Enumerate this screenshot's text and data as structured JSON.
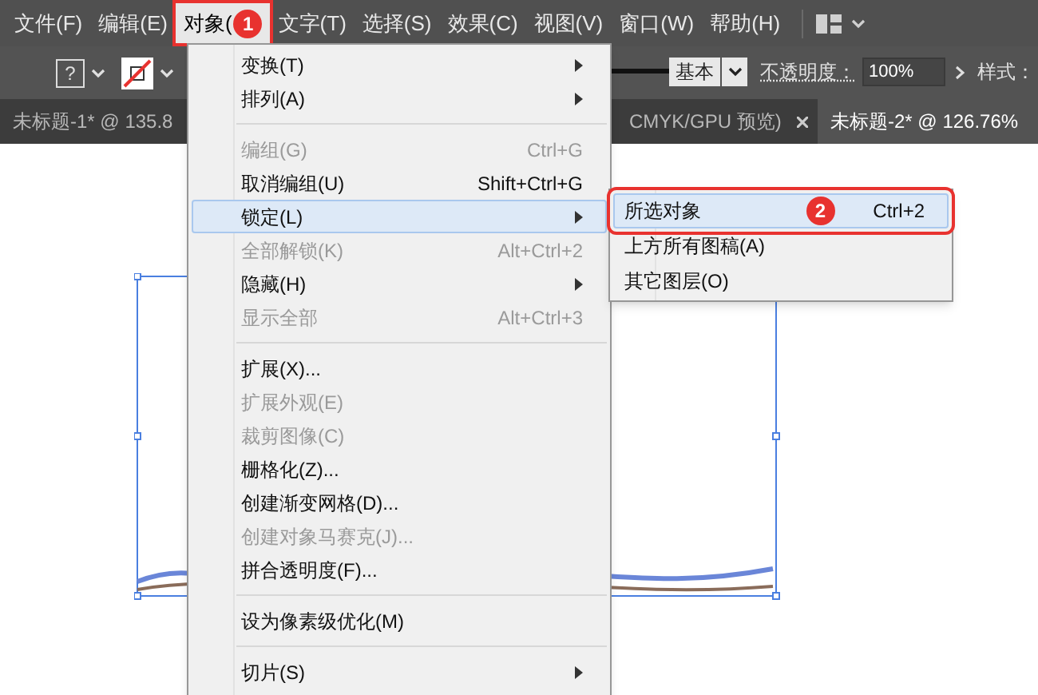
{
  "menubar": [
    {
      "label": "文件(F)",
      "selected": false
    },
    {
      "label": "编辑(E)",
      "selected": false
    },
    {
      "label": "对象(",
      "selected": true,
      "badge": "1"
    },
    {
      "label": "文字(T)",
      "selected": false
    },
    {
      "label": "选择(S)",
      "selected": false
    },
    {
      "label": "效果(C)",
      "selected": false
    },
    {
      "label": "视图(V)",
      "selected": false
    },
    {
      "label": "窗口(W)",
      "selected": false
    },
    {
      "label": "帮助(H)",
      "selected": false
    }
  ],
  "toolbar": {
    "fill_label": "?",
    "stroke_profile": "基本",
    "opacity_label": "不透明度：",
    "opacity_value": "100%",
    "style_label": "样式："
  },
  "tabs": [
    {
      "label": "未标题-1* @ 135.8",
      "selected": false
    },
    {
      "label": "CMYK/GPU 预览)",
      "selected": false,
      "closable": true
    },
    {
      "label": "未标题-2* @ 126.76%",
      "selected": true
    }
  ],
  "menu": [
    {
      "kind": "item",
      "label": "变换(T)",
      "submenu": true,
      "disabled": false,
      "selected": false
    },
    {
      "kind": "item",
      "label": "排列(A)",
      "submenu": true,
      "disabled": false,
      "selected": false
    },
    {
      "kind": "separator"
    },
    {
      "kind": "item",
      "label": "编组(G)",
      "shortcut": "Ctrl+G",
      "submenu": false,
      "disabled": true,
      "selected": false
    },
    {
      "kind": "item",
      "label": "取消编组(U)",
      "shortcut": "Shift+Ctrl+G",
      "submenu": false,
      "disabled": false,
      "selected": false
    },
    {
      "kind": "item",
      "label": "锁定(L)",
      "submenu": true,
      "disabled": false,
      "selected": true
    },
    {
      "kind": "item",
      "label": "全部解锁(K)",
      "shortcut": "Alt+Ctrl+2",
      "submenu": false,
      "disabled": true,
      "selected": false
    },
    {
      "kind": "item",
      "label": "隐藏(H)",
      "submenu": true,
      "disabled": false,
      "selected": false
    },
    {
      "kind": "item",
      "label": "显示全部",
      "shortcut": "Alt+Ctrl+3",
      "submenu": false,
      "disabled": true,
      "selected": false
    },
    {
      "kind": "separator"
    },
    {
      "kind": "item",
      "label": "扩展(X)...",
      "submenu": false,
      "disabled": false,
      "selected": false
    },
    {
      "kind": "item",
      "label": "扩展外观(E)",
      "submenu": false,
      "disabled": true,
      "selected": false
    },
    {
      "kind": "item",
      "label": "裁剪图像(C)",
      "submenu": false,
      "disabled": true,
      "selected": false
    },
    {
      "kind": "item",
      "label": "栅格化(Z)...",
      "submenu": false,
      "disabled": false,
      "selected": false
    },
    {
      "kind": "item",
      "label": "创建渐变网格(D)...",
      "submenu": false,
      "disabled": false,
      "selected": false
    },
    {
      "kind": "item",
      "label": "创建对象马赛克(J)...",
      "submenu": false,
      "disabled": true,
      "selected": false
    },
    {
      "kind": "item",
      "label": "拼合透明度(F)...",
      "submenu": false,
      "disabled": false,
      "selected": false
    },
    {
      "kind": "separator"
    },
    {
      "kind": "item",
      "label": "设为像素级优化(M)",
      "submenu": false,
      "disabled": false,
      "selected": false
    },
    {
      "kind": "separator"
    },
    {
      "kind": "item",
      "label": "切片(S)",
      "submenu": true,
      "disabled": false,
      "selected": false
    }
  ],
  "submenu": [
    {
      "label": "所选对象",
      "shortcut": "Ctrl+2",
      "selected": true,
      "badge": "2"
    },
    {
      "label": "上方所有图稿(A)",
      "selected": false
    },
    {
      "label": "其它图层(O)",
      "selected": false
    }
  ]
}
